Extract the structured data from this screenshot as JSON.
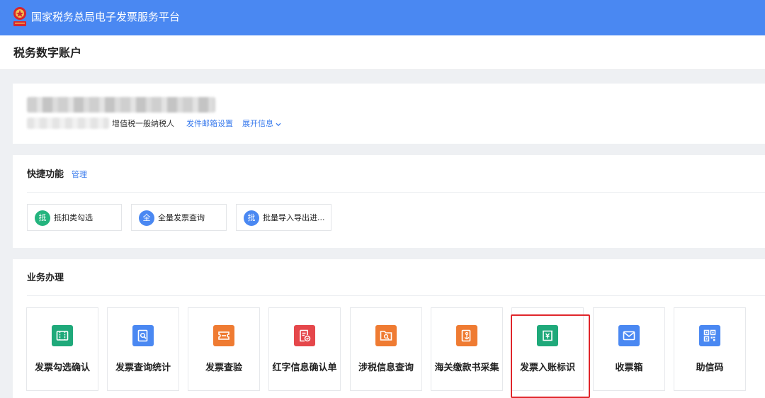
{
  "topbar": {
    "title": "国家税务总局电子发票服务平台"
  },
  "page": {
    "title": "税务数字账户"
  },
  "taxpayer": {
    "type": "增值税一般纳税人",
    "mail_link": "发件邮箱设置",
    "expand_link": "展开信息"
  },
  "quick": {
    "title": "快捷功能",
    "manage": "管理",
    "items": [
      {
        "badge": "抵",
        "label": "抵扣类勾选",
        "color": "#24b47e"
      },
      {
        "badge": "全",
        "label": "全量发票查询",
        "color": "#4a88f2"
      },
      {
        "badge": "批",
        "label": "批量导入导出进...",
        "color": "#4a88f2"
      }
    ]
  },
  "business": {
    "title": "业务办理",
    "tiles": [
      {
        "label": "发票勾选确认",
        "icon": "invoice-check-icon",
        "color": "#1fa97a"
      },
      {
        "label": "发票查询统计",
        "icon": "invoice-search-icon",
        "color": "#4a88f2"
      },
      {
        "label": "发票查验",
        "icon": "invoice-verify-icon",
        "color": "#ef7b32"
      },
      {
        "label": "红字信息确认单",
        "icon": "red-letter-icon",
        "color": "#e5474b"
      },
      {
        "label": "涉税信息查询",
        "icon": "tax-info-search-icon",
        "color": "#ef7b32"
      },
      {
        "label": "海关缴款书采集",
        "icon": "customs-collect-icon",
        "color": "#ef7b32"
      },
      {
        "label": "发票入账标识",
        "icon": "invoice-accounting-icon",
        "color": "#1fa97a"
      },
      {
        "label": "收票箱",
        "icon": "mailbox-icon",
        "color": "#4a88f2"
      },
      {
        "label": "助信码",
        "icon": "qr-code-icon",
        "color": "#4a88f2"
      }
    ]
  }
}
